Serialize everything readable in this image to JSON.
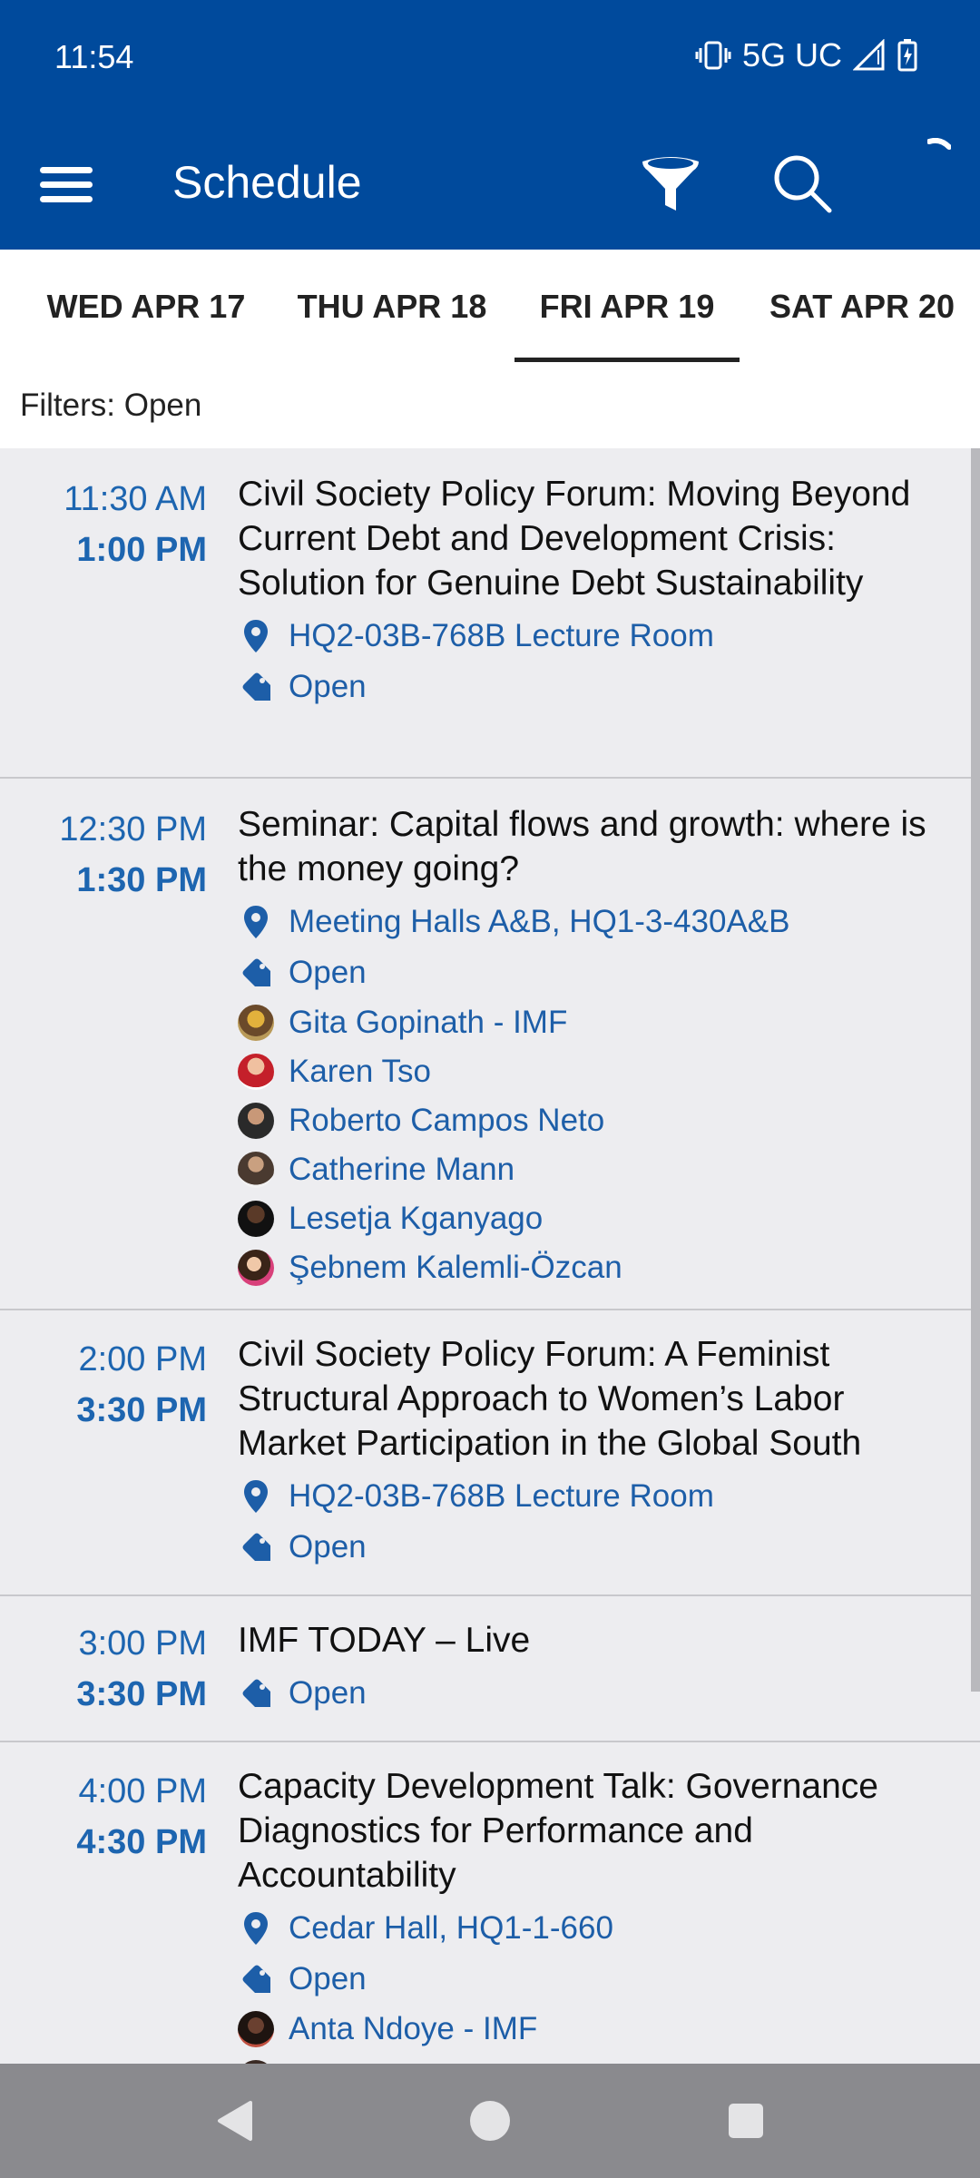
{
  "status_bar": {
    "time": "11:54",
    "network": "5G UC"
  },
  "app_bar": {
    "title": "Schedule"
  },
  "tabs": [
    {
      "label": "WED APR 17"
    },
    {
      "label": "THU APR 18"
    },
    {
      "label": "FRI APR 19",
      "selected": true
    },
    {
      "label": "SAT APR 20"
    }
  ],
  "filters": {
    "text": "Filters: Open"
  },
  "colors": {
    "brand": "#004a9c",
    "link": "#1d5ea8",
    "time": "#1d65b0"
  },
  "sessions": [
    {
      "start": "11:30 AM",
      "end": "1:00 PM",
      "title": "Civil Society Policy Forum: Moving Beyond Current Debt and Development Crisis: Solution for Genuine Debt Sustainability",
      "location": "HQ2-03B-768B Lecture Room",
      "tag": "Open",
      "speakers": []
    },
    {
      "start": "12:30 PM",
      "end": "1:30 PM",
      "title": "Seminar: Capital flows and growth: where is the money going?",
      "location": "Meeting Halls A&B, HQ1-3-430A&B",
      "tag": "Open",
      "speakers": [
        "Gita Gopinath - IMF",
        "Karen Tso",
        "Roberto Campos Neto",
        "Catherine Mann",
        "Lesetja Kganyago",
        "Şebnem Kalemli-Özcan"
      ]
    },
    {
      "start": "2:00 PM",
      "end": "3:30 PM",
      "title": "Civil Society Policy Forum: A Feminist Structural Approach to Women’s Labor Market Participation in the Global South",
      "location": "HQ2-03B-768B Lecture Room",
      "tag": "Open",
      "speakers": []
    },
    {
      "start": "3:00 PM",
      "end": "3:30 PM",
      "title": "IMF TODAY – Live",
      "tag": "Open",
      "speakers": []
    },
    {
      "start": "4:00 PM",
      "end": "4:30 PM",
      "title": "Capacity Development Talk: Governance Diagnostics for Performance and Accountability",
      "location": "Cedar Hall, HQ1-1-660",
      "tag": "Open",
      "speakers": [
        "Anta Ndoye - IMF"
      ]
    }
  ]
}
